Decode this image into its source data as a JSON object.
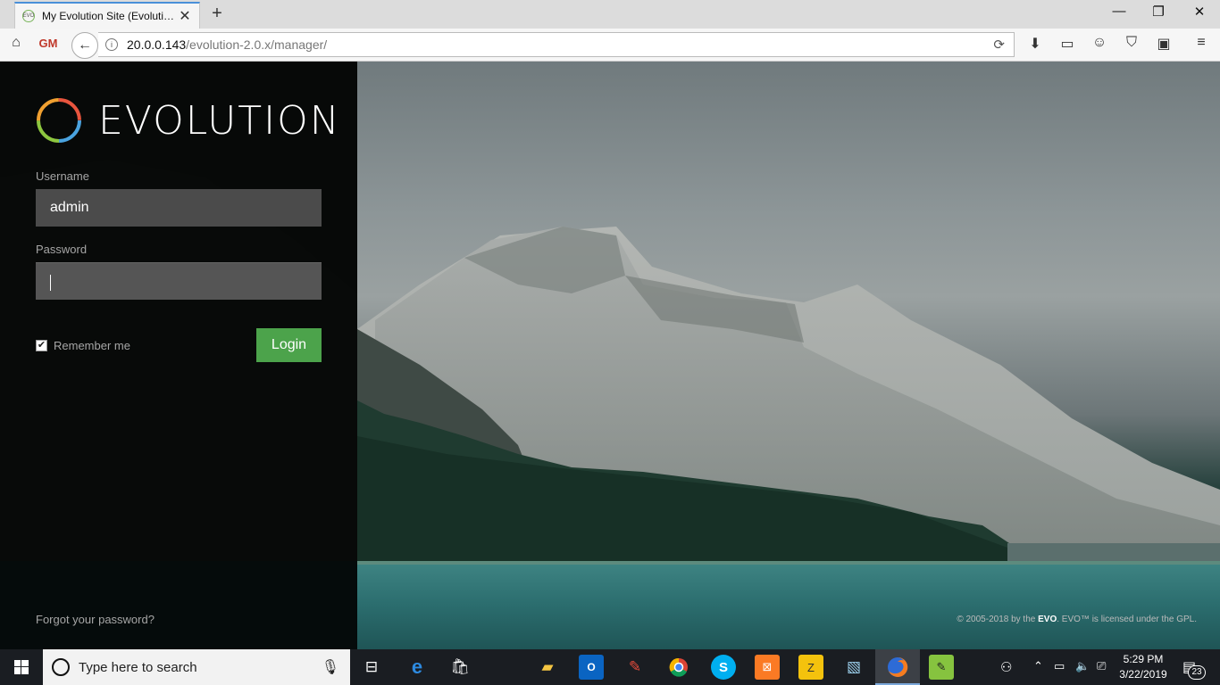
{
  "browser": {
    "tab_title": "My Evolution Site (Evoluti…",
    "tab_favicon": "EVO",
    "url_host": "20.0.0.143",
    "url_path": "/evolution-2.0.x/manager/",
    "icons": [
      "home-icon",
      "gm-icon",
      "back-icon",
      "info-icon",
      "reload-icon",
      "download-icon",
      "reader-icon",
      "chat-icon",
      "pocket-icon",
      "screen-icon",
      "menu-icon"
    ],
    "gm_label": "GM"
  },
  "login": {
    "logo_text": "EVOLUTION",
    "username_label": "Username",
    "username_value": "admin",
    "password_label": "Password",
    "password_value": "",
    "remember_label": "Remember me",
    "remember_checked": true,
    "login_button": "Login",
    "forgot_link": "Forgot your password?",
    "copyright_pre": "© 2005-2018 by the ",
    "copyright_brand": "EVO",
    "copyright_post": ". EVO™ is licensed under the GPL."
  },
  "taskbar": {
    "search_placeholder": "Type here to search",
    "time": "5:29 PM",
    "date": "3/22/2019",
    "notification_count": "23",
    "pinned": [
      "task-view-icon",
      "edge-icon",
      "store-icon",
      "file-explorer-icon",
      "outlook-icon",
      "paint-icon",
      "chrome-icon",
      "skype-icon",
      "xampp-icon",
      "filezilla-icon",
      "notepad-icon",
      "firefox-icon",
      "notepadpp-icon"
    ]
  },
  "colors": {
    "login_green": "#4ca34b",
    "panel_bg": "#000000",
    "taskbar_bg": "#1a1d22"
  }
}
